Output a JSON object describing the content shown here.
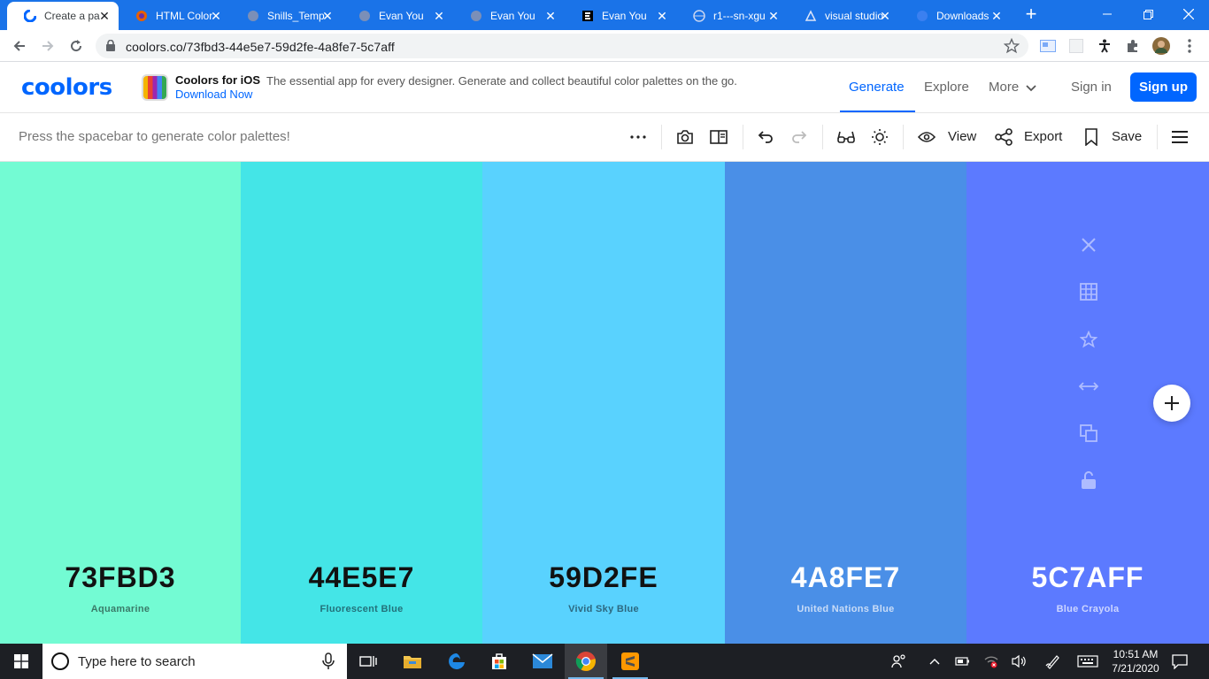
{
  "browser": {
    "tabs": [
      {
        "title": "Create a pa",
        "active": true
      },
      {
        "title": "HTML Color",
        "active": false
      },
      {
        "title": "Snills_Temp",
        "active": false
      },
      {
        "title": "Evan You",
        "active": false
      },
      {
        "title": "Evan You",
        "active": false
      },
      {
        "title": "Evan You",
        "active": false
      },
      {
        "title": "r1---sn-xgu",
        "active": false
      },
      {
        "title": "visual studio",
        "active": false
      },
      {
        "title": "Downloads",
        "active": false
      }
    ],
    "url": "coolors.co/73fbd3-44e5e7-59d2fe-4a8fe7-5c7aff"
  },
  "site": {
    "logo": "coolors",
    "promo": {
      "title": "Coolors for iOS",
      "description": "The essential app for every designer. Generate and collect beautiful color palettes on the go.",
      "link": "Download Now"
    },
    "nav": {
      "generate": "Generate",
      "explore": "Explore",
      "more": "More",
      "signin": "Sign in",
      "signup": "Sign up"
    }
  },
  "generator": {
    "hint": "Press the spacebar to generate color palettes!",
    "view_label": "View",
    "export_label": "Export",
    "save_label": "Save"
  },
  "palette": [
    {
      "hex": "73FBD3",
      "name": "Aquamarine",
      "color": "#73fbd3",
      "text_color": "#111111",
      "sub_color": "#3a7a68"
    },
    {
      "hex": "44E5E7",
      "name": "Fluorescent Blue",
      "color": "#44e5e7",
      "text_color": "#111111",
      "sub_color": "#23717a"
    },
    {
      "hex": "59D2FE",
      "name": "Vivid Sky Blue",
      "color": "#59d2fe",
      "text_color": "#111111",
      "sub_color": "#2c6880"
    },
    {
      "hex": "4A8FE7",
      "name": "United Nations Blue",
      "color": "#4a8fe7",
      "text_color": "#ffffff",
      "sub_color": "#c9dcf7"
    },
    {
      "hex": "5C7AFF",
      "name": "Blue Crayola",
      "color": "#5c7aff",
      "text_color": "#ffffff",
      "sub_color": "#cdd6ff"
    }
  ],
  "taskbar": {
    "search_placeholder": "Type here to search",
    "time": "10:51 AM",
    "date": "7/21/2020"
  }
}
